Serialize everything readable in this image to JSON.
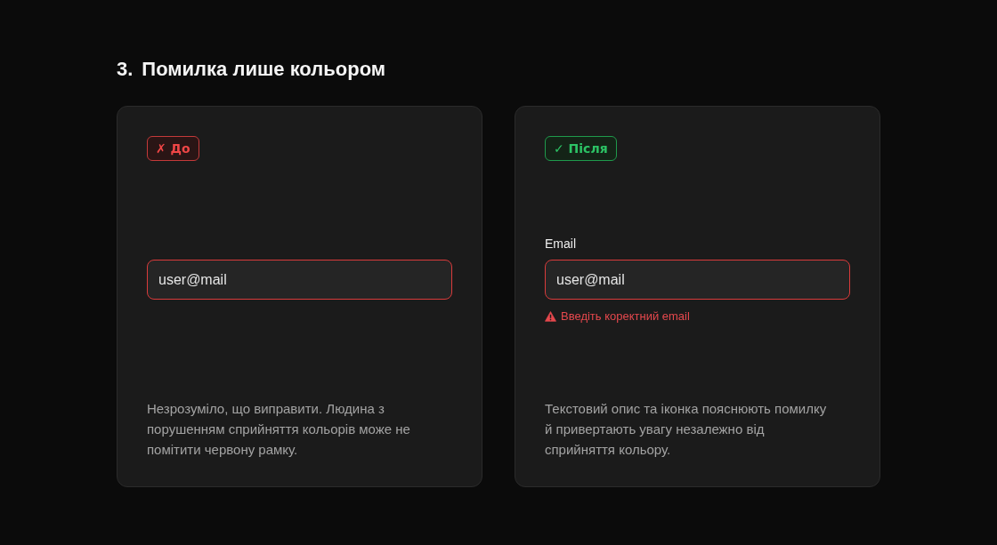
{
  "section": {
    "number": "3.",
    "title": "Помилка лише кольором"
  },
  "panels": [
    {
      "kind": "before",
      "badge": "✗ До",
      "field": {
        "value": "user@mail",
        "invalid": true
      },
      "description": "Незрозуміло, що виправити. Людина з порушенням сприйняття кольорів може не помітити червону рамку."
    },
    {
      "kind": "after",
      "badge": "✓ Після",
      "field": {
        "label": "Email",
        "value": "user@mail",
        "invalid": true,
        "error": "Введіть коректний email"
      },
      "description": "Текстовий опис та іконка пояснюють помилку й привертають увагу незалежно від сприйняття кольору."
    }
  ]
}
